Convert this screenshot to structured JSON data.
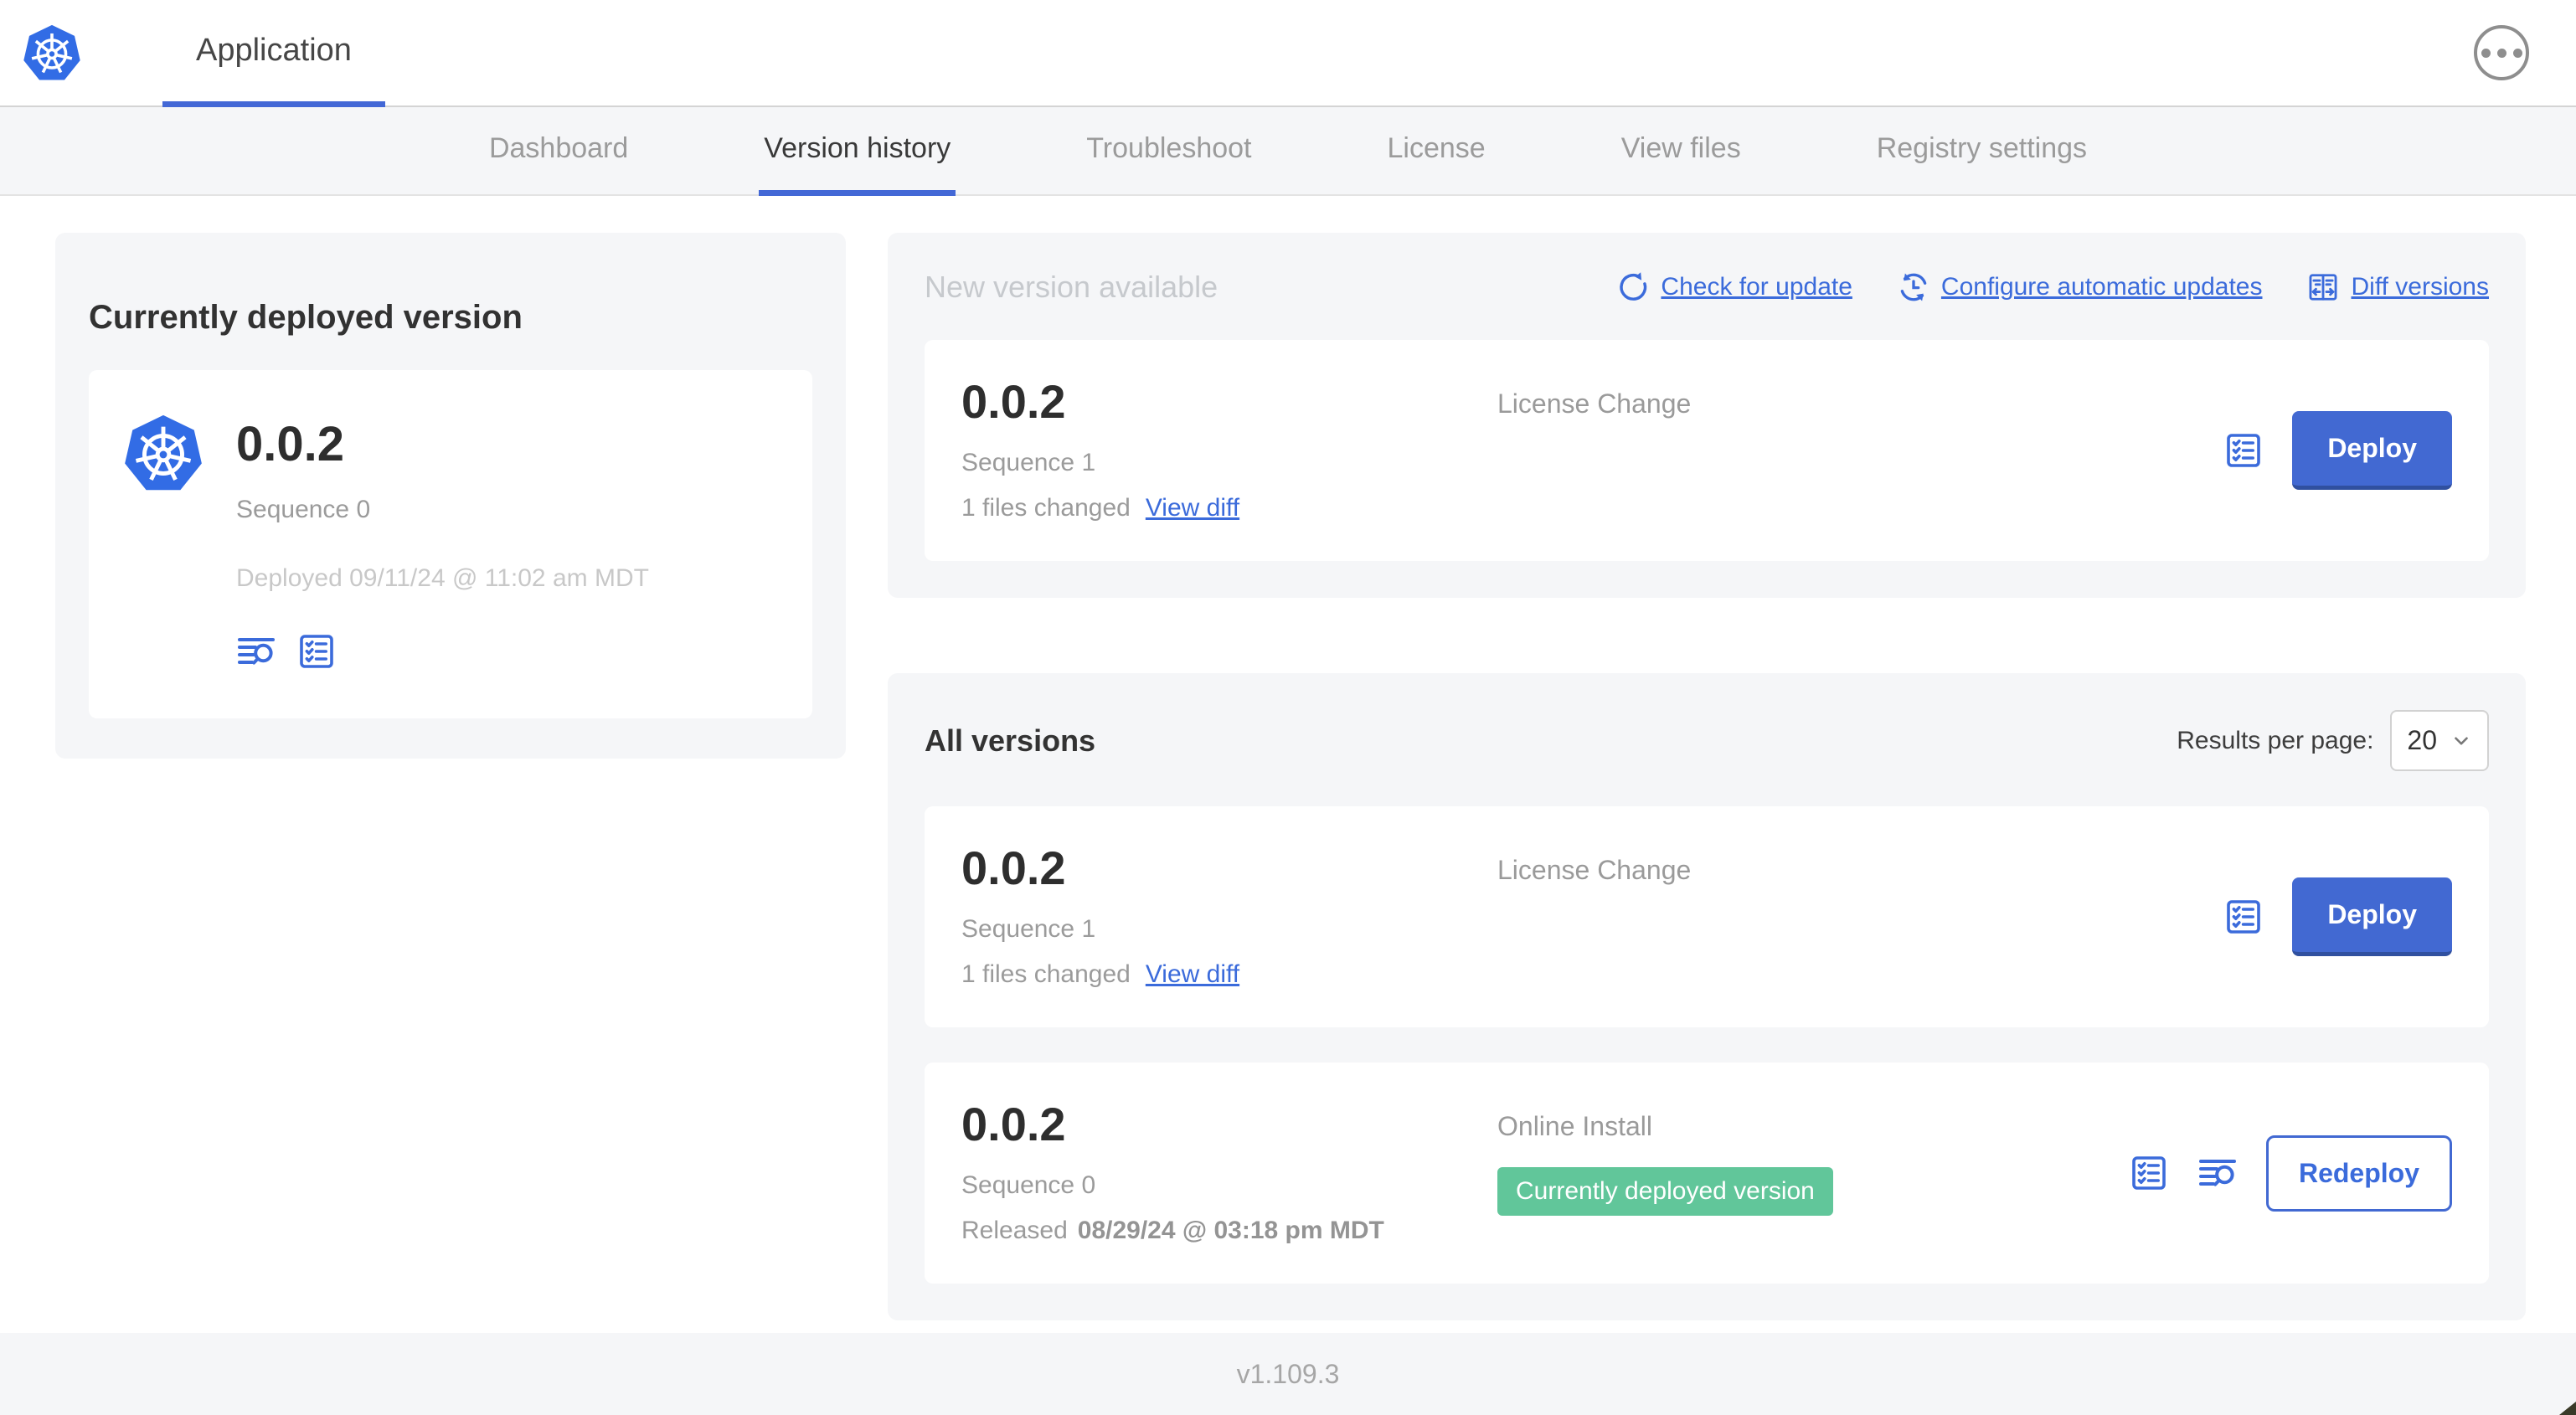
{
  "header": {
    "app_name": "Application"
  },
  "nav": {
    "tabs": [
      {
        "label": "Dashboard",
        "active": false
      },
      {
        "label": "Version history",
        "active": true
      },
      {
        "label": "Troubleshoot",
        "active": false
      },
      {
        "label": "License",
        "active": false
      },
      {
        "label": "View files",
        "active": false
      },
      {
        "label": "Registry settings",
        "active": false
      }
    ]
  },
  "current_version": {
    "title": "Currently deployed version",
    "version": "0.0.2",
    "sequence": "Sequence 0",
    "deployed": "Deployed 09/11/24 @ 11:02 am MDT"
  },
  "new_version": {
    "title": "New version available",
    "check_for_update": "Check for update",
    "configure_automatic_updates": "Configure automatic updates",
    "diff_versions": "Diff versions",
    "row": {
      "version": "0.0.2",
      "sequence": "Sequence 1",
      "files_changed": "1 files changed",
      "view_diff": "View diff",
      "source": "License Change",
      "action": "Deploy"
    }
  },
  "all_versions": {
    "title": "All versions",
    "results_per_page_label": "Results per page:",
    "results_per_page": "20",
    "rows": [
      {
        "version": "0.0.2",
        "sequence": "Sequence 1",
        "files_changed": "1 files changed",
        "view_diff": "View diff",
        "source": "License Change",
        "action": "Deploy"
      },
      {
        "version": "0.0.2",
        "sequence": "Sequence 0",
        "released_prefix": "Released",
        "released_date": "08/29/24 @ 03:18 pm MDT",
        "source": "Online Install",
        "badge": "Currently deployed version",
        "action": "Redeploy"
      }
    ]
  },
  "footer": {
    "app_version": "v1.109.3"
  },
  "icons": {
    "brand": "kubernetes-logo",
    "menu": "ellipsis-icon",
    "check_for_update": "refresh-icon",
    "configure_automatic_updates": "auto-update-icon",
    "diff_versions": "diff-icon",
    "preflight": "checklist-icon",
    "logs": "file-search-icon",
    "select": "chevron-down-icon"
  },
  "colors": {
    "accent_blue": "#3b6bdb",
    "button_blue": "#4269d2",
    "kubernetes_blue": "#326ce5",
    "badge_green": "#61c69a",
    "card_gray": "#f5f6f8"
  }
}
